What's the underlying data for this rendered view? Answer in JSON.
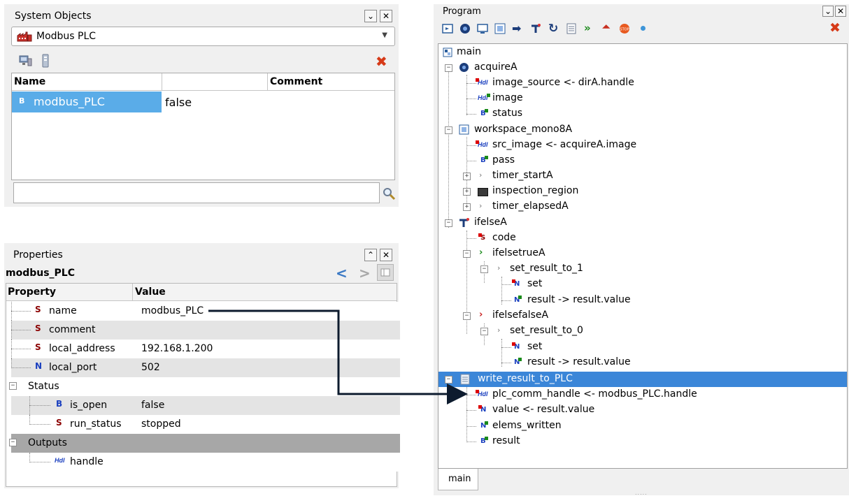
{
  "system_objects": {
    "title": "System Objects",
    "selector_value": "Modbus PLC",
    "columns": [
      "Name",
      "Comment"
    ],
    "rows": [
      {
        "type": "B",
        "name": "modbus_PLC",
        "value": "false"
      }
    ],
    "search_placeholder": ""
  },
  "properties": {
    "title": "Properties",
    "object_name": "modbus_PLC",
    "columns": [
      "Property",
      "Value"
    ],
    "rows": [
      {
        "type": "S",
        "name": "name",
        "value": "modbus_PLC"
      },
      {
        "type": "S",
        "name": "comment",
        "value": ""
      },
      {
        "type": "S",
        "name": "local_address",
        "value": "192.168.1.200"
      },
      {
        "type": "N",
        "name": "local_port",
        "value": "502"
      }
    ],
    "status_group": "Status",
    "status_rows": [
      {
        "type": "B",
        "name": "is_open",
        "value": "false"
      },
      {
        "type": "S",
        "name": "run_status",
        "value": "stopped"
      }
    ],
    "outputs_group": "Outputs",
    "outputs_rows": [
      {
        "type": "Hdl",
        "name": "handle"
      }
    ]
  },
  "program": {
    "title": "Program",
    "tab": "main",
    "tree": {
      "main": "main",
      "acquireA": "acquireA",
      "acq_1": "image_source <- dirA.handle",
      "acq_2": "image",
      "acq_3": "status",
      "workspace": "workspace_mono8A",
      "ws_1": "src_image <- acquireA.image",
      "ws_2": "pass",
      "ws_3": "timer_startA",
      "ws_4": "inspection_region",
      "ws_5": "timer_elapsedA",
      "ifelse": "ifelseA",
      "if_code": "code",
      "if_true": "ifelsetrueA",
      "set1": "set_result_to_1",
      "set1_a": "set",
      "set1_b": "result -> result.value",
      "if_false": "ifelsefalseA",
      "set0": "set_result_to_0",
      "set0_a": "set",
      "set0_b": "result -> result.value",
      "write": "write_result_to_PLC",
      "w_1": "plc_comm_handle <- modbus_PLC.handle",
      "w_2": "value <- result.value",
      "w_3": "elems_written",
      "w_4": "result"
    }
  },
  "type_labels": {
    "S": "S",
    "N": "N",
    "B": "B",
    "Hdl": "Hdl"
  },
  "colors": {
    "selection": "#3b86d8",
    "arrow": "#0d1b2e",
    "string": "#8b0000",
    "number": "#1a3fbf"
  }
}
